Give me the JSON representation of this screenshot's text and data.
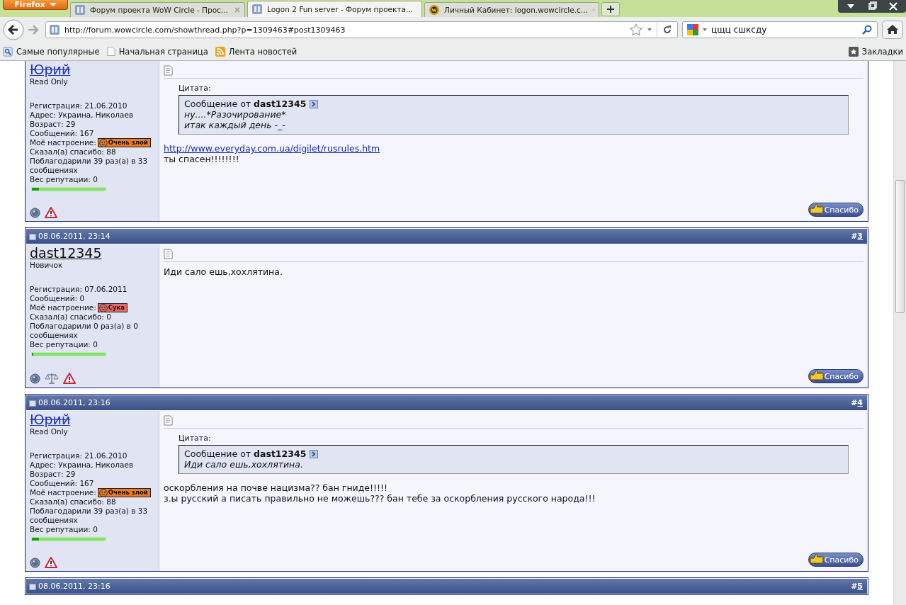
{
  "browser": {
    "menu_button": "Firefox",
    "tabs": [
      {
        "title": "Форум проекта WoW Circle - Прос...",
        "selected": false,
        "kind": "forum"
      },
      {
        "title": "Logon 2 Fun server - Форум проекта...",
        "selected": true,
        "kind": "forum"
      },
      {
        "title": "Личный Кабинет: logon.wowcircle.c...",
        "selected": false,
        "kind": "game"
      }
    ],
    "url": "http://forum.wowcircle.com/showthread.php?p=1309463#post1309463",
    "search": "цщц сшксду",
    "bookmarks": [
      {
        "label": "Самые популярные",
        "kind": "popular"
      },
      {
        "label": "Начальная страница",
        "kind": "page"
      },
      {
        "label": "Лента новостей",
        "kind": "feed"
      }
    ],
    "bookmarks_menu": "Закладки"
  },
  "posts": [
    {
      "user": {
        "name": "Юрий",
        "banned": true,
        "title": "Read Only"
      },
      "stats": [
        {
          "kind": "text",
          "text": "Регистрация: 21.06.2010"
        },
        {
          "kind": "text",
          "text": "Адрес: Украина, Николаев"
        },
        {
          "kind": "text",
          "text": "Возраст: 29"
        },
        {
          "kind": "text",
          "text": "Сообщений: 167"
        },
        {
          "kind": "mood",
          "label": "Моё настроение:",
          "badge": "Очень злой",
          "color": "#f07a1c"
        },
        {
          "kind": "text",
          "text": "Сказал(а) спасибо: 88"
        },
        {
          "kind": "text",
          "text": "Поблагодарили 39 раз(а) в 33 сообщениях"
        },
        {
          "kind": "text",
          "text": "Вес репутации: 0"
        }
      ],
      "reputation": {
        "level": 0.1
      },
      "actions": [
        {
          "kind": "status"
        },
        {
          "kind": "report"
        }
      ],
      "content": [
        {
          "kind": "quote",
          "label": "Цитата:",
          "prefix": "Сообщение от",
          "author": "dast12345",
          "lines": [
            "ну....*Разочирование*",
            "итак каждый день -_-"
          ]
        },
        {
          "kind": "link",
          "text": "http://www.everyday.com.ua/digilet/rusrules.htm"
        },
        {
          "kind": "text",
          "text": "ты спасен!!!!!!!!"
        }
      ],
      "thanks": "Спасибо"
    },
    {
      "date": "08.06.2011, 23:14",
      "hash": "#",
      "number": "3",
      "user": {
        "name": "dast12345",
        "banned": false,
        "title": "Новичок"
      },
      "stats": [
        {
          "kind": "text",
          "text": "Регистрация: 07.06.2011"
        },
        {
          "kind": "text",
          "text": "Сообщений: 0"
        },
        {
          "kind": "mood",
          "label": "Моё настроение:",
          "badge": "Сука",
          "color": "#e86868"
        },
        {
          "kind": "text",
          "text": "Сказал(а) спасибо: 0"
        },
        {
          "kind": "text",
          "text": "Поблагодарили 0 раз(а) в 0 сообщениях"
        },
        {
          "kind": "text",
          "text": "Вес репутации: 0"
        }
      ],
      "reputation": {
        "level": 0.02
      },
      "actions": [
        {
          "kind": "status"
        },
        {
          "kind": "scales"
        },
        {
          "kind": "report"
        }
      ],
      "content": [
        {
          "kind": "text",
          "text": "Иди сало ешь,хохлятина."
        }
      ],
      "thanks": "Спасибо"
    },
    {
      "date": "08.06.2011, 23:16",
      "hash": "#",
      "number": "4",
      "user": {
        "name": "Юрий",
        "banned": true,
        "title": "Read Only"
      },
      "stats": [
        {
          "kind": "text",
          "text": "Регистрация: 21.06.2010"
        },
        {
          "kind": "text",
          "text": "Адрес: Украина, Николаев"
        },
        {
          "kind": "text",
          "text": "Возраст: 29"
        },
        {
          "kind": "text",
          "text": "Сообщений: 167"
        },
        {
          "kind": "mood",
          "label": "Моё настроение:",
          "badge": "Очень злой",
          "color": "#f07a1c"
        },
        {
          "kind": "text",
          "text": "Сказал(а) спасибо: 88"
        },
        {
          "kind": "text",
          "text": "Поблагодарили 39 раз(а) в 33 сообщениях"
        },
        {
          "kind": "text",
          "text": "Вес репутации: 0"
        }
      ],
      "reputation": {
        "level": 0.1
      },
      "actions": [
        {
          "kind": "status"
        },
        {
          "kind": "report"
        }
      ],
      "content": [
        {
          "kind": "quote",
          "label": "Цитата:",
          "prefix": "Сообщение от",
          "author": "dast12345",
          "lines": [
            "Иди сало ешь,хохлятина."
          ]
        },
        {
          "kind": "text",
          "text": "оскорбления на почве нацизма?? бан гниде!!!!!"
        },
        {
          "kind": "text",
          "text": "з.ы русский а писать правильно не можешь??? бан тебе за оскорбления русского народа!!!"
        }
      ],
      "thanks": "Спасибо"
    },
    {
      "date": "08.06.2011, 23:16",
      "hash": "#",
      "number": "5"
    }
  ]
}
